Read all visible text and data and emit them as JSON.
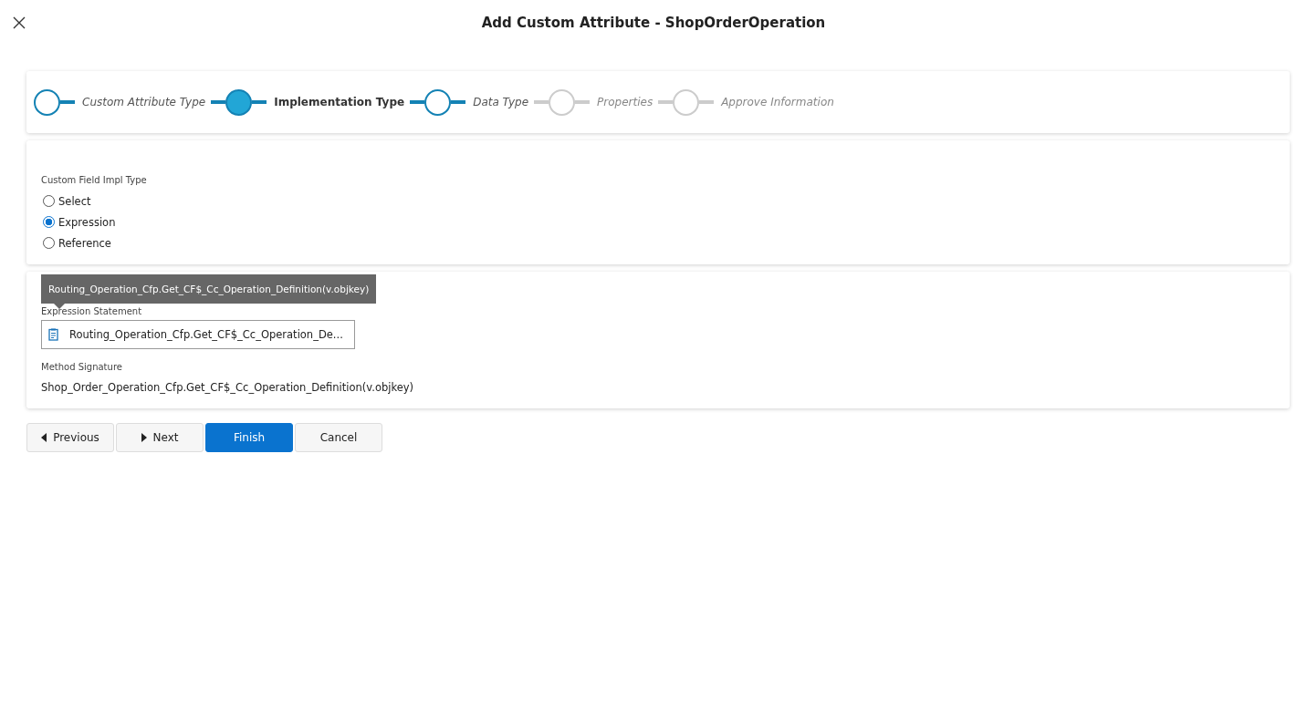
{
  "window": {
    "title": "Add Custom Attribute - ShopOrderOperation"
  },
  "steps": [
    {
      "label": "Custom Attribute Type",
      "reached": true,
      "selected": false
    },
    {
      "label": "Implementation Type",
      "reached": true,
      "selected": true
    },
    {
      "label": "Data Type",
      "reached": true,
      "selected": false
    },
    {
      "label": "Properties",
      "reached": false,
      "selected": false
    },
    {
      "label": "Approve Information",
      "reached": false,
      "selected": false
    }
  ],
  "impl_type": {
    "label": "Custom Field Impl Type",
    "options": [
      {
        "label": "Select",
        "selected": false
      },
      {
        "label": "Expression",
        "selected": true
      },
      {
        "label": "Reference",
        "selected": false
      }
    ]
  },
  "expression": {
    "label": "Expression Statement",
    "value": "Routing_Operation_Cfp.Get_CF$_Cc_Operation_De...",
    "tooltip": "Routing_Operation_Cfp.Get_CF$_Cc_Operation_Definition(v.objkey)",
    "signature_label": "Method Signature",
    "signature": "Shop_Order_Operation_Cfp.Get_CF$_Cc_Operation_Definition(v.objkey)"
  },
  "buttons": [
    {
      "label": "Previous",
      "kind": "prev"
    },
    {
      "label": "Next",
      "kind": "next"
    },
    {
      "label": "Finish",
      "kind": "primary"
    },
    {
      "label": "Cancel",
      "kind": "plain"
    }
  ]
}
